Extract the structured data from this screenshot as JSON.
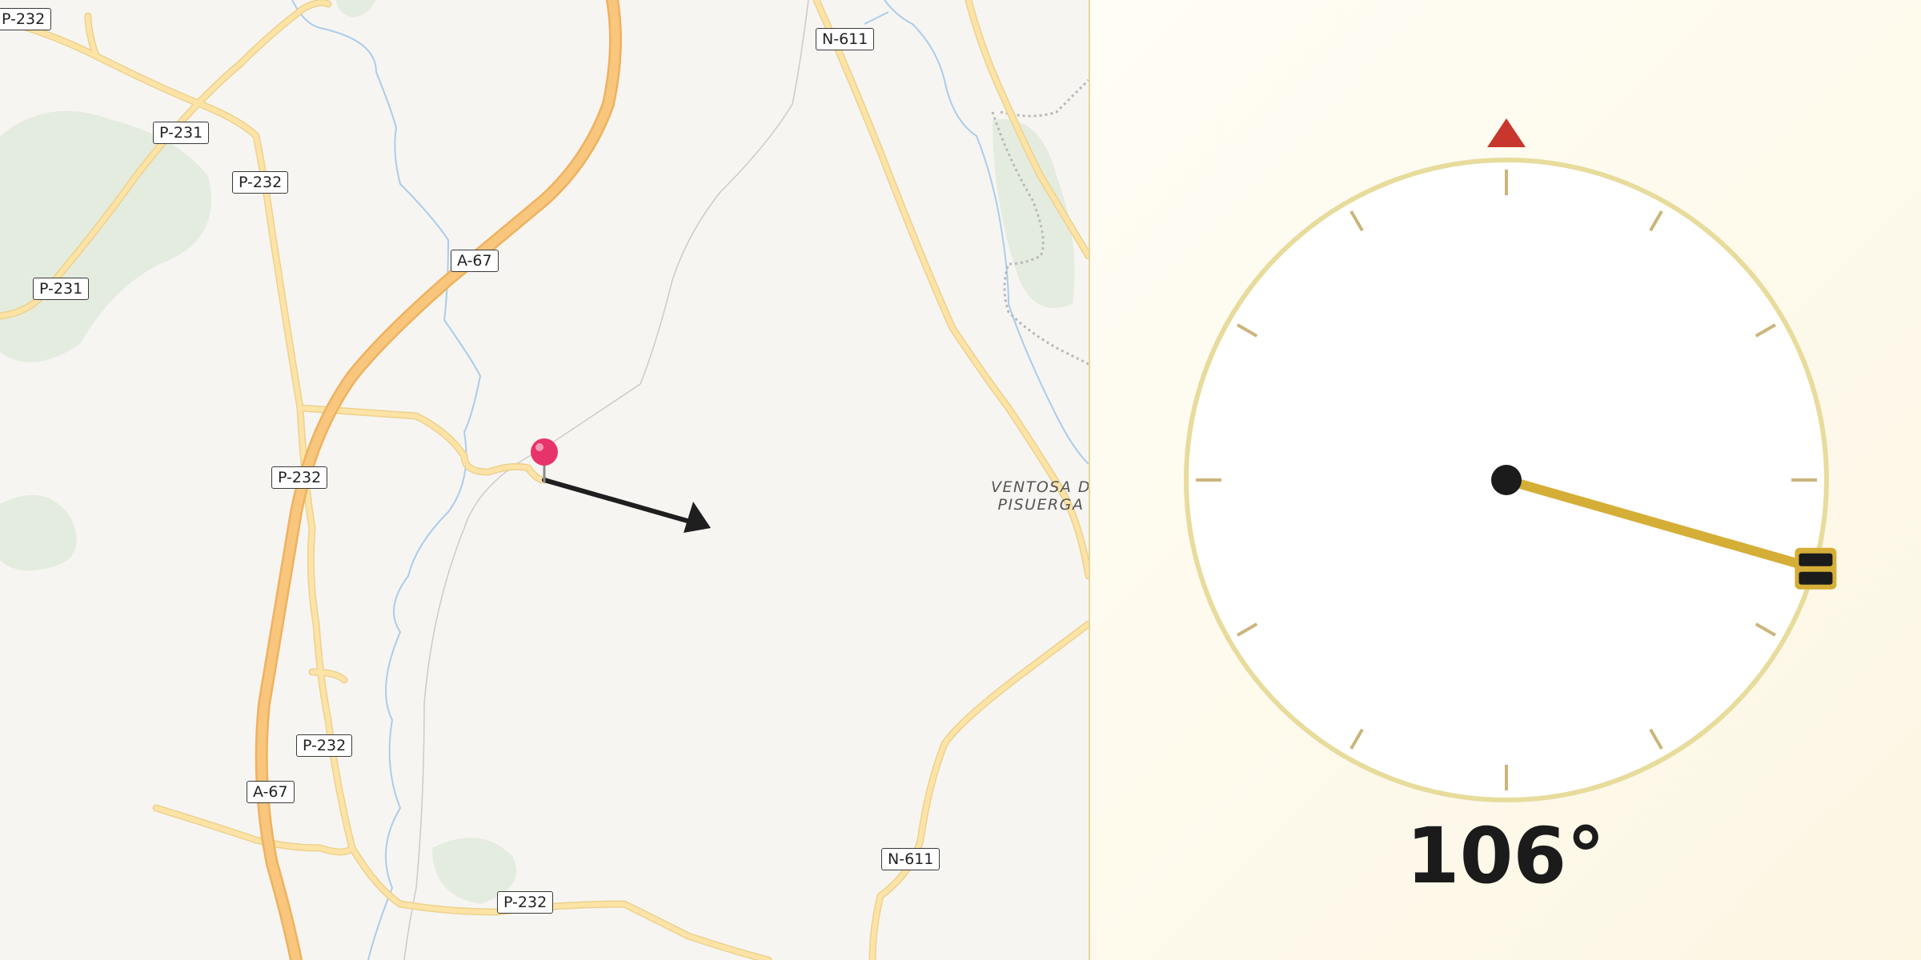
{
  "map": {
    "road_labels": [
      "P-232",
      "P-231",
      "P-232",
      "P-231",
      "A-67",
      "P-232",
      "N-611",
      "P-232",
      "A-67",
      "N-611",
      "P-232"
    ],
    "town_label": [
      "VENTOSA D",
      "PISUERGA"
    ],
    "marker": "location-pin-icon",
    "direction_arrow": "direction-arrow-icon",
    "colors": {
      "background": "#f7f5f2",
      "motorway": "#f8c67c",
      "road": "#fbdc94",
      "water": "#a9cdec",
      "park": "#e6ece0"
    }
  },
  "compass": {
    "heading_degrees": 106,
    "heading_text": "106°",
    "north_marker": "north-triangle-icon",
    "colors": {
      "needle": "#d4ae37",
      "dial_rim": "#e7dc9c",
      "north": "#c8372d",
      "readout": "#1b1b1b"
    }
  }
}
